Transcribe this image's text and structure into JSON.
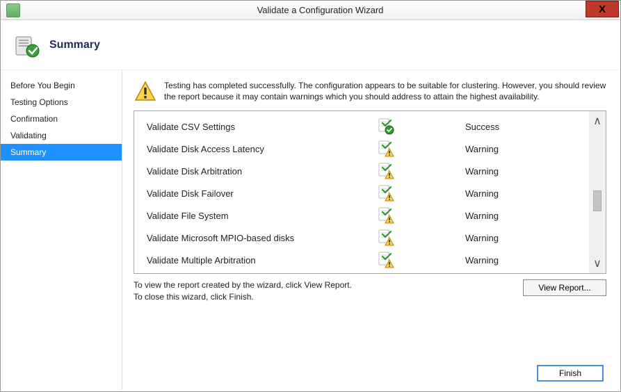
{
  "window": {
    "title": "Validate a Configuration Wizard",
    "close_label": "X"
  },
  "header": {
    "title": "Summary"
  },
  "sidebar": {
    "items": [
      {
        "label": "Before You Begin",
        "active": false
      },
      {
        "label": "Testing Options",
        "active": false
      },
      {
        "label": "Confirmation",
        "active": false
      },
      {
        "label": "Validating",
        "active": false
      },
      {
        "label": "Summary",
        "active": true
      }
    ]
  },
  "message": {
    "text": "Testing has completed successfully. The configuration appears to be suitable for clustering.  However, you should review the report because it may contain warnings which you should address to attain the highest availability."
  },
  "results": [
    {
      "name": "Validate CSV Settings",
      "status": "Success",
      "icon": "success"
    },
    {
      "name": "Validate Disk Access Latency",
      "status": "Warning",
      "icon": "warning"
    },
    {
      "name": "Validate Disk Arbitration",
      "status": "Warning",
      "icon": "warning"
    },
    {
      "name": "Validate Disk Failover",
      "status": "Warning",
      "icon": "warning"
    },
    {
      "name": "Validate File System",
      "status": "Warning",
      "icon": "warning"
    },
    {
      "name": "Validate Microsoft MPIO-based disks",
      "status": "Warning",
      "icon": "warning"
    },
    {
      "name": "Validate Multiple Arbitration",
      "status": "Warning",
      "icon": "warning"
    }
  ],
  "footer": {
    "line1": "To view the report created by the wizard, click View Report.",
    "line2": "To close this wizard, click Finish.",
    "view_report_label": "View Report...",
    "finish_label": "Finish"
  }
}
